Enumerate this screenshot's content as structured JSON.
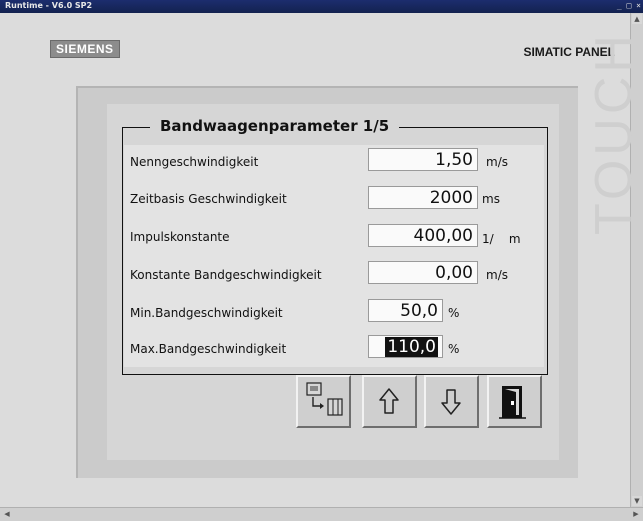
{
  "window": {
    "title": "Runtime - V6.0 SP2",
    "buttons": "_ □ ×"
  },
  "brand": {
    "logo": "SIEMENS",
    "product": "SIMATIC PANEL",
    "watermark": "TOUCH"
  },
  "screen": {
    "heading": "Bandwaagenparameter 1/5",
    "rows": [
      {
        "label": "Nenngeschwindigkeit",
        "value": "1,50",
        "unit": "m/s"
      },
      {
        "label": "Zeitbasis Geschwindigkeit",
        "value": "2000",
        "unit": "ms"
      },
      {
        "label": "Impulskonstante",
        "value": "400,00",
        "unit": "1/    m"
      },
      {
        "label": "Konstante Bandgeschwindigkeit",
        "value": "0,00",
        "unit": "m/s"
      },
      {
        "label": "Min.Bandgeschwindigkeit",
        "value": "50,0",
        "unit": "%"
      },
      {
        "label": "Max.Bandgeschwindigkeit",
        "value": "110,0",
        "unit": "%"
      }
    ],
    "buttons": [
      {
        "icon": "screen-change-icon"
      },
      {
        "icon": "arrow-up-icon"
      },
      {
        "icon": "arrow-down-icon"
      },
      {
        "icon": "exit-door-icon"
      }
    ]
  }
}
